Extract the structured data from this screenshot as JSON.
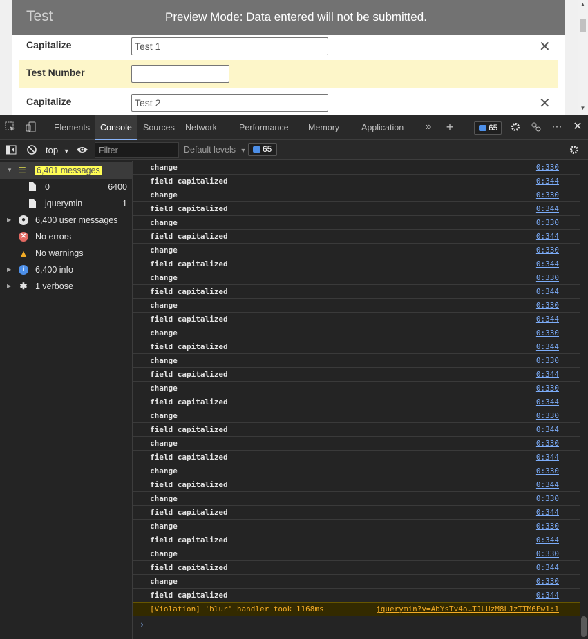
{
  "page": {
    "form_title": "Test",
    "preview_banner": "Preview Mode: Data entered will not be submitted.",
    "fields": [
      {
        "label": "Capitalize",
        "value": "Test 1",
        "remove": "✕"
      },
      {
        "label": "Test Number",
        "value": ""
      },
      {
        "label": "Capitalize",
        "value": "Test 2",
        "remove": "✕"
      }
    ]
  },
  "devtools": {
    "tabs": [
      "Elements",
      "Console",
      "Sources",
      "Network",
      "Performance",
      "Memory",
      "Application"
    ],
    "active_tab": "Console",
    "issues_count": "65",
    "toolbar": {
      "context": "top",
      "filter_placeholder": "Filter",
      "levels": "Default levels",
      "issues_count": "65"
    },
    "sidebar": {
      "messages": "6,401 messages",
      "files": [
        {
          "name": "0",
          "count": "6400"
        },
        {
          "name": "jquerymin",
          "count": "1"
        }
      ],
      "user_messages": "6,400 user messages",
      "errors": "No errors",
      "warnings": "No warnings",
      "info": "6,400 info",
      "verbose": "1 verbose"
    },
    "log_entries": [
      {
        "msg": "change",
        "src": "0:330"
      },
      {
        "msg": "field capitalized",
        "src": "0:344"
      },
      {
        "msg": "change",
        "src": "0:330"
      },
      {
        "msg": "field capitalized",
        "src": "0:344"
      },
      {
        "msg": "change",
        "src": "0:330"
      },
      {
        "msg": "field capitalized",
        "src": "0:344"
      },
      {
        "msg": "change",
        "src": "0:330"
      },
      {
        "msg": "field capitalized",
        "src": "0:344"
      },
      {
        "msg": "change",
        "src": "0:330"
      },
      {
        "msg": "field capitalized",
        "src": "0:344"
      },
      {
        "msg": "change",
        "src": "0:330"
      },
      {
        "msg": "field capitalized",
        "src": "0:344"
      },
      {
        "msg": "change",
        "src": "0:330"
      },
      {
        "msg": "field capitalized",
        "src": "0:344"
      },
      {
        "msg": "change",
        "src": "0:330"
      },
      {
        "msg": "field capitalized",
        "src": "0:344"
      },
      {
        "msg": "change",
        "src": "0:330"
      },
      {
        "msg": "field capitalized",
        "src": "0:344"
      },
      {
        "msg": "change",
        "src": "0:330"
      },
      {
        "msg": "field capitalized",
        "src": "0:344"
      },
      {
        "msg": "change",
        "src": "0:330"
      },
      {
        "msg": "field capitalized",
        "src": "0:344"
      },
      {
        "msg": "change",
        "src": "0:330"
      },
      {
        "msg": "field capitalized",
        "src": "0:344"
      },
      {
        "msg": "change",
        "src": "0:330"
      },
      {
        "msg": "field capitalized",
        "src": "0:344"
      },
      {
        "msg": "change",
        "src": "0:330"
      },
      {
        "msg": "field capitalized",
        "src": "0:344"
      },
      {
        "msg": "change",
        "src": "0:330"
      },
      {
        "msg": "field capitalized",
        "src": "0:344"
      },
      {
        "msg": "change",
        "src": "0:330"
      },
      {
        "msg": "field capitalized",
        "src": "0:344"
      }
    ],
    "violation": {
      "msg": "[Violation] 'blur' handler took 1168ms",
      "src": "jquerymin?v=AbYsTv4o…TJLUzM8LJzTTM6Ew1:1"
    },
    "prompt": "›"
  }
}
